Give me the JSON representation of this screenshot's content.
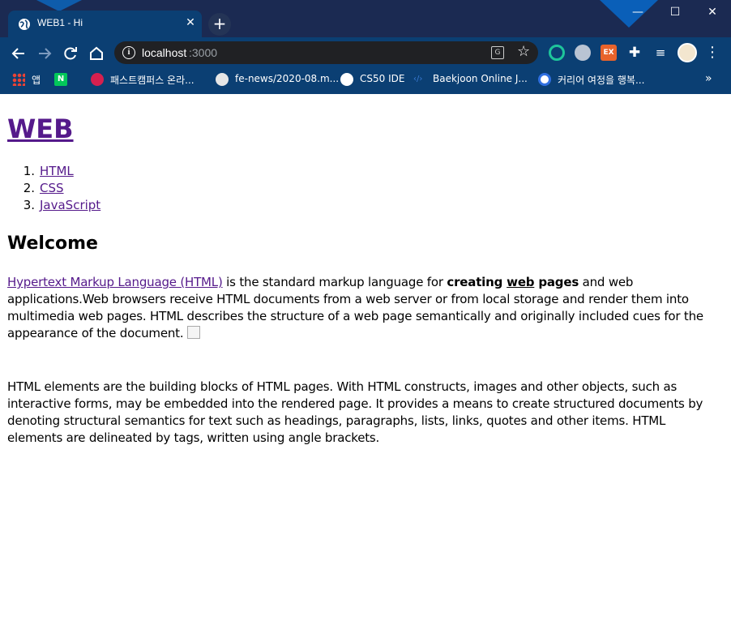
{
  "browser": {
    "tab_title": "WEB1 - Hi",
    "url_host": "localhost",
    "url_port": ":3000",
    "window_controls": {
      "minimize": "—",
      "maximize": "☐",
      "close": "✕"
    },
    "new_tab": "+",
    "ext3_label": "EX",
    "bookmarks": [
      {
        "label": "앱",
        "icon": "apps-icon"
      },
      {
        "label": "",
        "icon": "naver-icon",
        "badge": "N"
      },
      {
        "label": "패스트캠퍼스 온라...",
        "icon": "fastcampus-icon"
      },
      {
        "label": "fe-news/2020-08.m...",
        "icon": "github-icon"
      },
      {
        "label": "CS50 IDE",
        "icon": "globe-icon"
      },
      {
        "label": "Baekjoon Online J...",
        "icon": "code-icon"
      },
      {
        "label": "커리어 여정을 행복...",
        "icon": "career-icon"
      }
    ],
    "bookmarks_more": "»"
  },
  "page": {
    "title": "WEB",
    "nav": [
      {
        "num": "1.",
        "label": "HTML"
      },
      {
        "num": "2.",
        "label": "CSS"
      },
      {
        "num": "3.",
        "label": "JavaScript"
      }
    ],
    "heading": "Welcome",
    "p1": {
      "link": "Hypertext Markup Language (HTML)",
      "text_a": " is the standard markup language for ",
      "bold_a": "creating ",
      "bold_u": "web",
      "bold_b": " pages",
      "text_b": " and web applications.Web browsers receive HTML documents from a web server or from local storage and render them into multimedia web pages. HTML describes the structure of a web page semantically and originally included cues for the appearance of the document. "
    },
    "p2": "HTML elements are the building blocks of HTML pages. With HTML constructs, images and other objects, such as interactive forms, may be embedded into the rendered page. It provides a means to create structured documents by denoting structural semantics for text such as headings, paragraphs, lists, links, quotes and other items. HTML elements are delineated by tags, written using angle brackets."
  },
  "colors": {
    "titlebar": "#1b2a52",
    "toolbar": "#0b3f73",
    "visited_link": "#551a8b"
  }
}
